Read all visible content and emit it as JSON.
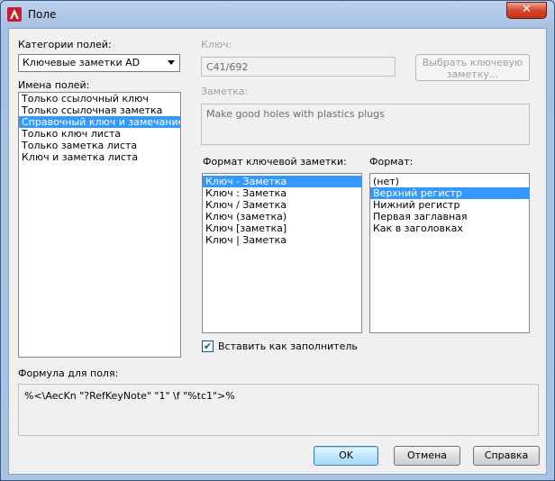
{
  "window": {
    "title": "Поле",
    "close_label": "✕"
  },
  "categories": {
    "label": "Категории полей:",
    "selected": "Ключевые заметки AD"
  },
  "names": {
    "label": "Имена полей:",
    "items": [
      "Только ссылочный ключ",
      "Только ссылочная заметка",
      "Справочный ключ и замечание",
      "Только ключ листа",
      "Только заметка листа",
      "Ключ и заметка листа"
    ],
    "selected_index": 2
  },
  "key": {
    "label": "Ключ:",
    "value": "C41/692",
    "choose_button": "Выбрать ключевую заметку..."
  },
  "note": {
    "label": "Заметка:",
    "value": "Make good holes with plastics plugs"
  },
  "keynote_format": {
    "label": "Формат ключевой заметки:",
    "items": [
      "Ключ  - Заметка",
      "Ключ  : Заметка",
      "Ключ  / Заметка",
      "Ключ (заметка)",
      "Ключ [заметка]",
      "Ключ | Заметка"
    ],
    "selected_index": 0
  },
  "format": {
    "label": "Формат:",
    "items": [
      "(нет)",
      "Верхний регистр",
      "Нижний регистр",
      "Первая заглавная",
      "Как в заголовках"
    ],
    "selected_index": 1
  },
  "placeholder_checkbox": {
    "label": "Вставить как заполнитель",
    "checked": true
  },
  "formula": {
    "label": "Формула для поля:",
    "value": "%<\\AecKn \"?RefKeyNote\" \"1\" \\f \"%tc1\">%"
  },
  "buttons": {
    "ok": "OK",
    "cancel": "Отмена",
    "help": "Справка"
  },
  "colors": {
    "selection": "#3399ff",
    "title_bar": "#bcd3ee",
    "close_button": "#d2472f"
  }
}
